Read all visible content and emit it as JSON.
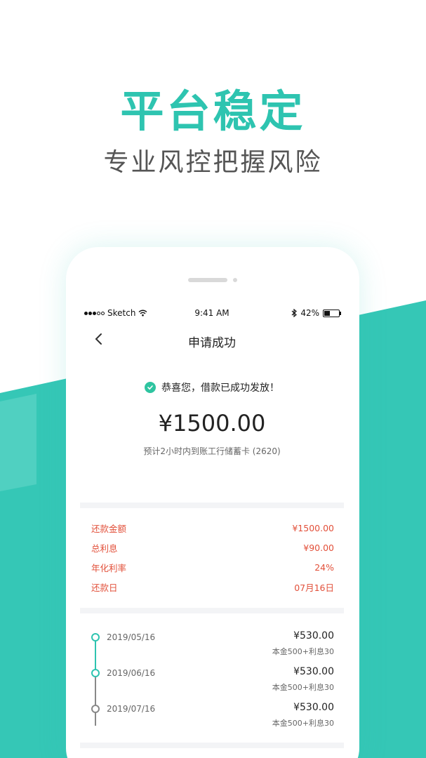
{
  "headline": "平台稳定",
  "subline": "专业风控把握风险",
  "colors": {
    "accent": "#2ec4b0",
    "teal_band": "#35c7b6",
    "red": "#e2503a"
  },
  "status_bar": {
    "carrier": "Sketch",
    "time": "9:41 AM",
    "battery": "42%",
    "battery_level": 0.42
  },
  "nav": {
    "back_icon": "chevron-left-icon",
    "title": "申请成功"
  },
  "success": {
    "icon": "check-circle-icon",
    "message": "恭喜您，借款已成功发放！"
  },
  "loan": {
    "amount": "¥1500.00",
    "arrival_note": "预计2小时内到账工行储蓄卡 (2620)"
  },
  "details": [
    {
      "label": "还款金额",
      "value": "¥1500.00"
    },
    {
      "label": "总利息",
      "value": "¥90.00"
    },
    {
      "label": "年化利率",
      "value": "24%"
    },
    {
      "label": "还款日",
      "value": "07月16日"
    }
  ],
  "schedule": [
    {
      "date": "2019/05/16",
      "amount": "¥530.00",
      "detail": "本金500+利息30"
    },
    {
      "date": "2019/06/16",
      "amount": "¥530.00",
      "detail": "本金500+利息30"
    },
    {
      "date": "2019/07/16",
      "amount": "¥530.00",
      "detail": "本金500+利息30"
    }
  ]
}
